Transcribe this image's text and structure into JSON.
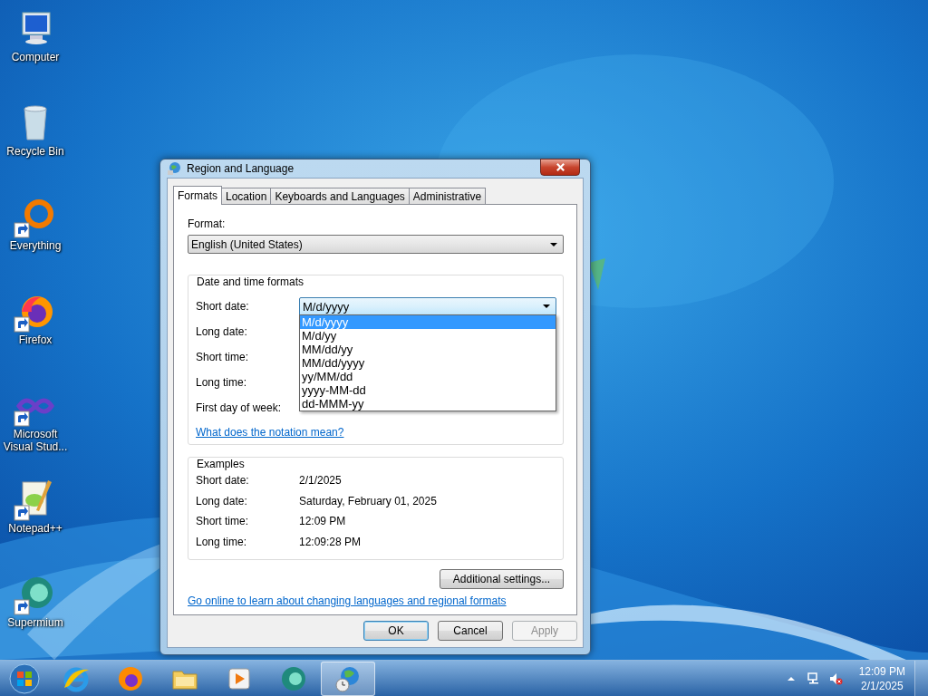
{
  "desktop_icons": [
    {
      "label": "Computer",
      "kind": "computer",
      "shortcut": false
    },
    {
      "label": "Recycle Bin",
      "kind": "bin",
      "shortcut": false
    },
    {
      "label": "Everything",
      "kind": "ring",
      "shortcut": true
    },
    {
      "label": "Firefox",
      "kind": "fox",
      "shortcut": true
    },
    {
      "label": "Microsoft Visual Stud...",
      "kind": "infinity",
      "shortcut": true
    },
    {
      "label": "Notepad++",
      "kind": "notepad",
      "shortcut": true
    },
    {
      "label": "Supermium",
      "kind": "swirl",
      "shortcut": true
    }
  ],
  "dialog": {
    "title": "Region and Language",
    "tabs": [
      {
        "label": "Formats",
        "selected": true
      },
      {
        "label": "Location",
        "selected": false
      },
      {
        "label": "Keyboards and Languages",
        "selected": false
      },
      {
        "label": "Administrative",
        "selected": false
      }
    ],
    "format_label": "Format:",
    "format_value": "English (United States)",
    "formats_group": {
      "title": "Date and time formats",
      "rows": [
        {
          "label": "Short date:",
          "value": "M/d/yyyy",
          "expanded": true
        },
        {
          "label": "Long date:"
        },
        {
          "label": "Short time:"
        },
        {
          "label": "Long time:"
        },
        {
          "label": "First day of week:"
        }
      ],
      "options": [
        {
          "label": "M/d/yyyy",
          "selected": true
        },
        {
          "label": "M/d/yy",
          "selected": false
        },
        {
          "label": "MM/dd/yy",
          "selected": false
        },
        {
          "label": "MM/dd/yyyy",
          "selected": false
        },
        {
          "label": "yy/MM/dd",
          "selected": false
        },
        {
          "label": "yyyy-MM-dd",
          "selected": false
        },
        {
          "label": "dd-MMM-yy",
          "selected": false
        }
      ],
      "link": "What does the notation mean?"
    },
    "examples": {
      "title": "Examples",
      "rows": [
        {
          "label": "Short date:",
          "value": "2/1/2025"
        },
        {
          "label": "Long date:",
          "value": "Saturday, February 01, 2025"
        },
        {
          "label": "Short time:",
          "value": "12:09 PM"
        },
        {
          "label": "Long time:",
          "value": "12:09:28 PM"
        }
      ]
    },
    "additional_button": "Additional settings...",
    "online_link": "Go online to learn about changing languages and regional formats",
    "buttons": [
      {
        "label": "OK",
        "disabled": false,
        "default": true
      },
      {
        "label": "Cancel",
        "disabled": false,
        "default": false
      },
      {
        "label": "Apply",
        "disabled": true,
        "default": false
      }
    ]
  },
  "taskbar": {
    "items": [
      {
        "kind": "ie",
        "selected": false
      },
      {
        "kind": "fox",
        "selected": false
      },
      {
        "kind": "folder",
        "selected": false
      },
      {
        "kind": "player",
        "selected": false
      },
      {
        "kind": "swirl",
        "selected": false
      },
      {
        "kind": "globe",
        "selected": true
      }
    ],
    "clock_time": "12:09 PM",
    "clock_date": "2/1/2025"
  }
}
